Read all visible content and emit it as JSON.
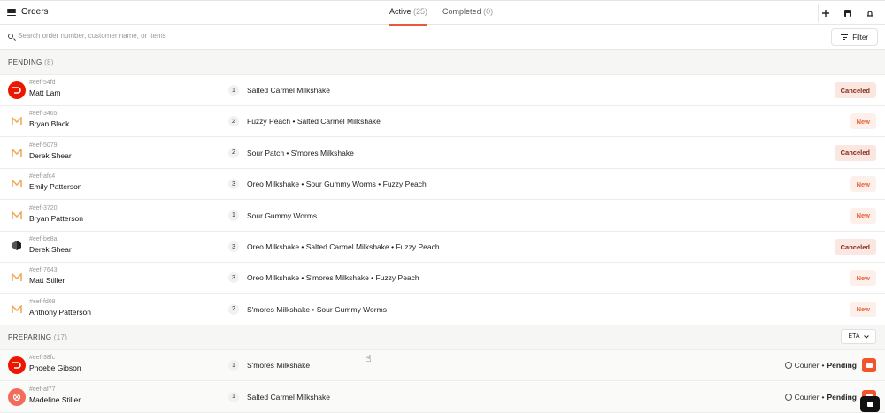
{
  "header": {
    "title": "Orders",
    "tabs": [
      {
        "label": "Active",
        "count": "(25)",
        "active": true
      },
      {
        "label": "Completed",
        "count": "(0)",
        "active": false
      }
    ],
    "actions": [
      "plus-icon",
      "store-icon",
      "notification-icon"
    ]
  },
  "search": {
    "placeholder": "Search order number, customer name, or items",
    "value": ""
  },
  "filter": {
    "label": "Filter"
  },
  "sections": [
    {
      "title": "PENDING",
      "count": "(8)"
    },
    {
      "title": "PREPARING",
      "count": "(17)",
      "sort_label": "ETA"
    }
  ],
  "pending_orders": [
    {
      "id": "#eef-54fd",
      "customer": "Matt Lam",
      "qty": "1",
      "items": "Salted Carmel Milkshake",
      "status": "Canceled",
      "platform": "doordash"
    },
    {
      "id": "#eef-3465",
      "customer": "Bryan Black",
      "qty": "2",
      "items": "Fuzzy Peach • Salted Carmel Milkshake",
      "status": "New",
      "platform": "menu"
    },
    {
      "id": "#eef-5079",
      "customer": "Derek Shear",
      "qty": "2",
      "items": "Sour Patch • S'mores Milkshake",
      "status": "Canceled",
      "platform": "menu"
    },
    {
      "id": "#eef-afc4",
      "customer": "Emily Patterson",
      "qty": "3",
      "items": "Oreo Milkshake • Sour Gummy Worms • Fuzzy Peach",
      "status": "New",
      "platform": "menu"
    },
    {
      "id": "#eef-3720",
      "customer": "Bryan Patterson",
      "qty": "1",
      "items": "Sour Gummy Worms",
      "status": "New",
      "platform": "menu"
    },
    {
      "id": "#eef-be8a",
      "customer": "Derek Shear",
      "qty": "3",
      "items": "Oreo Milkshake • Salted Carmel Milkshake • Fuzzy Peach",
      "status": "Canceled",
      "platform": "grubhub"
    },
    {
      "id": "#eef-7643",
      "customer": "Matt Stiller",
      "qty": "3",
      "items": "Oreo Milkshake • S'mores Milkshake • Fuzzy Peach",
      "status": "New",
      "platform": "menu"
    },
    {
      "id": "#eef-fd08",
      "customer": "Anthony Patterson",
      "qty": "2",
      "items": "S'mores Milkshake • Sour Gummy Worms",
      "status": "New",
      "platform": "menu"
    }
  ],
  "preparing_orders": [
    {
      "id": "#eef-38fc",
      "customer": "Phoebe Gibson",
      "qty": "1",
      "items": "S'mores Milkshake",
      "courier_label": "Courier",
      "courier_status": "Pending",
      "platform": "doordash"
    },
    {
      "id": "#eef-af77",
      "customer": "Madeline Stiller",
      "qty": "1",
      "items": "Salted Carmel Milkshake",
      "courier_label": "Courier",
      "courier_status": "Pending",
      "platform": "ubereats"
    }
  ],
  "colors": {
    "accent": "#e85a3c",
    "doordash": "#eb1700",
    "canceled_bg": "#fbe7e2",
    "new_text": "#e6653f"
  }
}
